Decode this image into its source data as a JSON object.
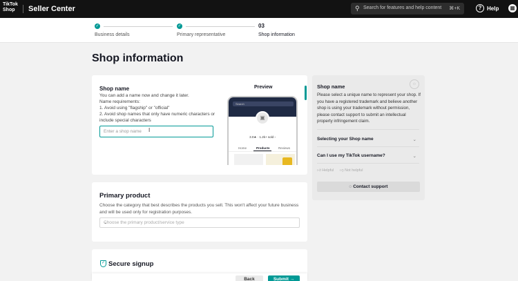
{
  "topbar": {
    "logo_line1": "TikTok",
    "logo_line2": "Shop",
    "brand": "Seller Center",
    "search_placeholder": "Search for features and help content",
    "search_shortcut": "⌘+K",
    "help_label": "Help"
  },
  "stepper": {
    "steps": [
      {
        "label": "Business details",
        "state": "done"
      },
      {
        "label": "Primary representative",
        "state": "done"
      },
      {
        "number": "03",
        "label": "Shop information",
        "state": "active"
      }
    ]
  },
  "page": {
    "title": "Shop information"
  },
  "shop_name_card": {
    "title": "Shop name",
    "desc1": "You can add a name now and change it later.",
    "desc2": "Name requirements:",
    "desc3": "1. Avoid using \"flagship\" or \"official\"",
    "desc4": "2. Avoid shop names that only have numeric characters or include special characters",
    "input_placeholder": "Enter a shop name",
    "preview_label": "Preview",
    "phone": {
      "search": "Search",
      "stats": "3.0★ · 1.2k+ sold ›",
      "tabs": [
        "Home",
        "Products",
        "Reviews"
      ]
    }
  },
  "primary_product_card": {
    "title": "Primary product",
    "desc": "Choose the category that best describes the products you sell. This won't affect your future business and will be used only for registration purposes.",
    "select_placeholder": "Choose the primary product/service type"
  },
  "secure_card": {
    "title": "Secure signup"
  },
  "footer": {
    "back_label": "Back",
    "submit_label": "Submit →"
  },
  "help_panel": {
    "title": "Shop name",
    "desc": "Please select a unique name to represent your shop. If you have a registered trademark and believe another shop is using your trademark without permission, please contact support to submit an intellectual property infringement claim.",
    "faqs": [
      "Selecting your Shop name",
      "Can I use my TikTok username?"
    ],
    "helpful_label": "Helpful",
    "not_helpful_label": "Not helpful",
    "contact_label": "Contact support"
  },
  "colors": {
    "accent": "#009995",
    "topbar": "#121212",
    "background": "#f2f2f2"
  }
}
